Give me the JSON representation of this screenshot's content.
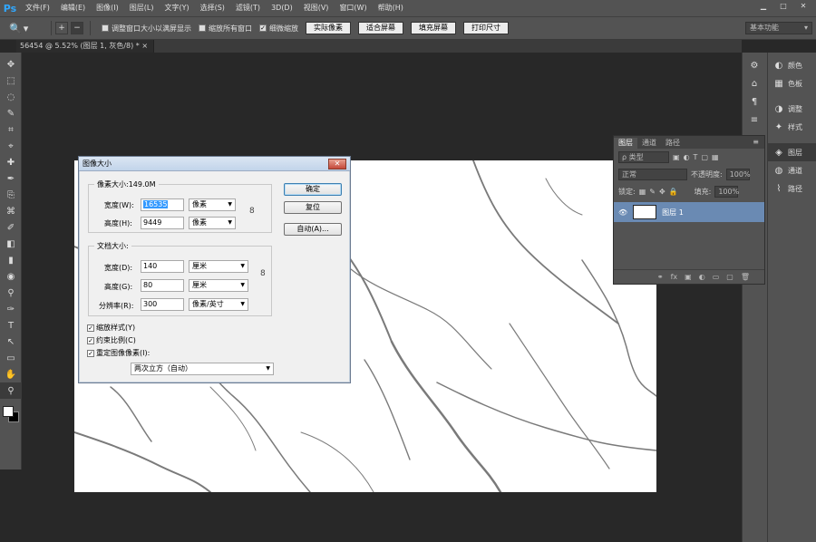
{
  "app": {
    "logo": "Ps"
  },
  "menu": [
    "文件(F)",
    "编辑(E)",
    "图像(I)",
    "图层(L)",
    "文字(Y)",
    "选择(S)",
    "滤镜(T)",
    "3D(D)",
    "视图(V)",
    "窗口(W)",
    "帮助(H)"
  ],
  "window_controls": {
    "minimize": "▁",
    "maximize": "□",
    "close": "✕"
  },
  "options": {
    "zoom_tool": "🔍",
    "resize_windows": "调整窗口大小以满屏显示",
    "zoom_all": "缩放所有窗口",
    "scrubby": "细微缩放",
    "btn_actual": "实际像素",
    "btn_fit": "适合屏幕",
    "btn_fill": "填充屏幕",
    "btn_print": "打印尺寸",
    "workspace": "基本功能"
  },
  "document_tab": {
    "title": "56454 @ 5.52% (图层 1, 灰色/8) *",
    "close": "×"
  },
  "tools": [
    "✥",
    "⬚",
    "◌",
    "✎",
    "⌗",
    "⌖",
    "✚",
    "✒",
    "⎘",
    "⌘",
    "✐",
    "◧",
    "▮",
    "◉",
    "⚲",
    "✑",
    "T",
    "↖",
    "▭",
    "✋",
    "⚲"
  ],
  "dock_narrow": [
    "⚙",
    "⌂",
    "¶",
    "≡"
  ],
  "dock_wide": [
    {
      "icon": "◐",
      "label": "颜色"
    },
    {
      "icon": "▦",
      "label": "色板"
    },
    {
      "icon": "◑",
      "label": "调整"
    },
    {
      "icon": "✦",
      "label": "样式"
    },
    {
      "icon": "◈",
      "label": "图层"
    },
    {
      "icon": "◍",
      "label": "通道"
    },
    {
      "icon": "⌇",
      "label": "路径"
    }
  ],
  "layers_panel": {
    "tabs": [
      "图层",
      "通道",
      "路径"
    ],
    "menu": "≡",
    "filter_label": "ρ 类型",
    "blend_mode": "正常",
    "opacity_label": "不透明度:",
    "opacity_value": "100%",
    "lock_label": "锁定:",
    "fill_label": "填充:",
    "fill_value": "100%",
    "layer_name": "图层 1",
    "visibility": "👁",
    "footer_icons": [
      "⚭",
      "fx",
      "▣",
      "◐",
      "▭",
      "▢",
      "🗑"
    ]
  },
  "dialog": {
    "title": "图像大小",
    "close": "✕",
    "pixel_dimensions_label": "像素大小:149.0M",
    "width_label": "宽度(W):",
    "width_value": "16535",
    "width_unit": "像素",
    "height_label": "高度(H):",
    "height_value": "9449",
    "height_unit": "像素",
    "doc_size_label": "文档大小:",
    "doc_width_label": "宽度(D):",
    "doc_width_value": "140",
    "doc_width_unit": "厘米",
    "doc_height_label": "高度(G):",
    "doc_height_value": "80",
    "doc_height_unit": "厘米",
    "resolution_label": "分辨率(R):",
    "resolution_value": "300",
    "resolution_unit": "像素/英寸",
    "scale_styles": "缩放样式(Y)",
    "constrain": "约束比例(C)",
    "resample": "重定图像像素(I):",
    "resample_method": "两次立方（自动）",
    "btn_ok": "确定",
    "btn_reset": "复位",
    "btn_auto": "自动(A)...",
    "check_mark": "✓",
    "chain_icon": "8"
  }
}
